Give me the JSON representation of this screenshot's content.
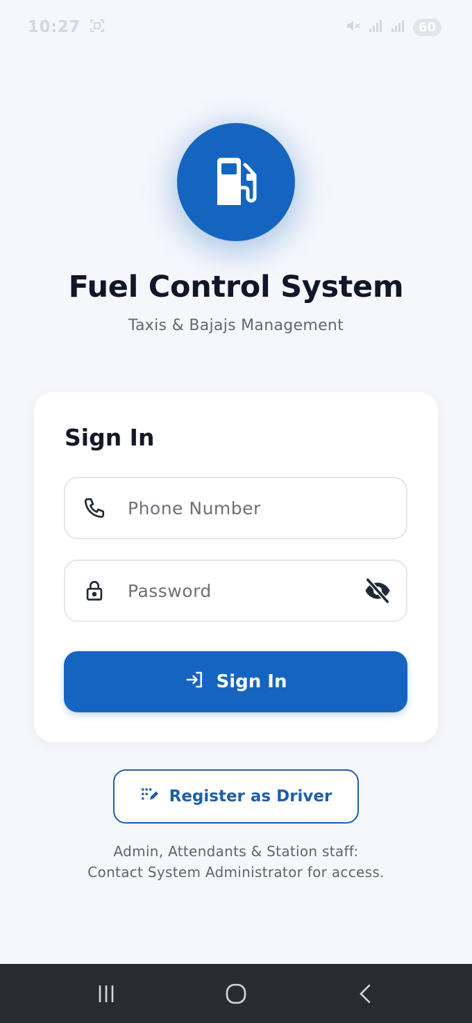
{
  "status_bar": {
    "time": "10:27",
    "battery": "60",
    "icons": [
      "screenshot-icon",
      "mute-icon",
      "signal-icon",
      "signal-icon",
      "battery-icon"
    ]
  },
  "app": {
    "title": "Fuel Control System",
    "subtitle": "Taxis & Bajajs Management",
    "logo_icon": "fuel-pump-icon",
    "brand_color": "#1565c0"
  },
  "sign_in_card": {
    "title": "Sign In",
    "phone_field": {
      "placeholder": "Phone Number",
      "value": "",
      "icon": "phone-icon"
    },
    "password_field": {
      "placeholder": "Password",
      "value": "",
      "icon": "lock-icon",
      "toggle_icon": "eye-off-icon"
    },
    "submit_button": {
      "label": "Sign In",
      "icon": "login-icon"
    }
  },
  "register": {
    "label": "Register as Driver",
    "icon": "register-icon"
  },
  "footnote": {
    "line1": "Admin, Attendants & Station staff:",
    "line2": "Contact System Administrator for access."
  },
  "nav_bar": {
    "buttons": [
      "recent-apps-icon",
      "home-icon",
      "back-icon"
    ]
  }
}
